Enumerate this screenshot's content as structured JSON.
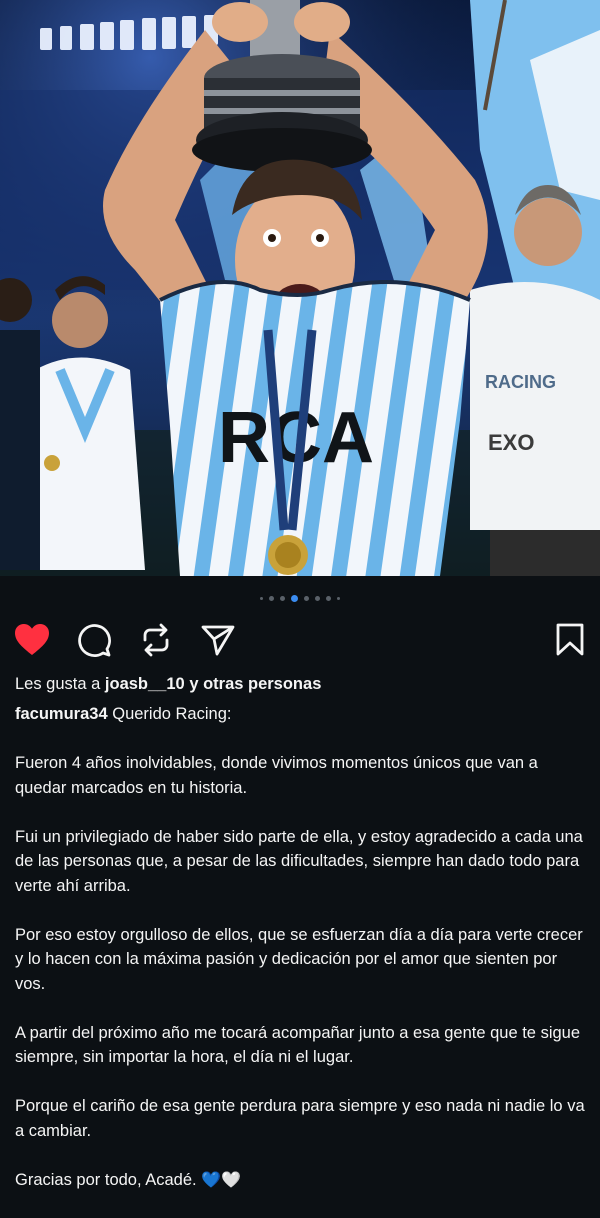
{
  "post": {
    "carousel": {
      "count": 8,
      "active_index": 3
    },
    "likes": {
      "prefix": "Les gusta a",
      "user": "joasb__10",
      "suffix": "y otras personas"
    },
    "caption": {
      "username": "facumura34",
      "opening": "Querido Racing:",
      "paragraphs": [
        "Fueron 4 años inolvidables, donde vivimos momentos únicos que van a quedar marcados en tu historia.",
        "Fui un privilegiado de haber sido parte de ella, y estoy agradecido a cada una de las personas que, a pesar de las dificultades, siempre han dado todo para verte ahí arriba.",
        "Por eso estoy orgulloso de ellos, que se esfuerzan día a día para verte crecer y lo hacen con la máxima pasión y dedicación por el amor que sienten por vos.",
        "A partir del próximo año me tocará acompañar junto a esa gente que te sigue siempre, sin importar la hora, el día ni el lugar.",
        "Porque el cariño de esa gente perdura para siempre y eso nada ni nadie lo va a cambiar."
      ],
      "closing": "Gracias por todo, Acadé.",
      "closing_emoji": "💙🤍"
    },
    "photo_text": {
      "shirt": "RCA",
      "right_shirt_1": "RACING",
      "right_shirt_2": "EXO"
    }
  },
  "icons": {
    "like": "heart-filled-icon",
    "comment": "comment-icon",
    "repost": "repost-icon",
    "share": "send-icon",
    "save": "bookmark-icon"
  },
  "colors": {
    "background": "#0c1014",
    "like_red": "#ff3040",
    "dot_active": "#3b8cf0",
    "racing_blue": "#6ab4e8"
  }
}
